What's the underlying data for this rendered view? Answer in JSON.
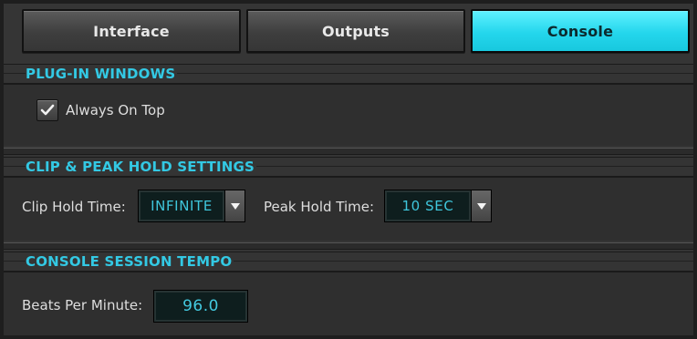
{
  "tabs": {
    "interface": "Interface",
    "outputs": "Outputs",
    "console": "Console"
  },
  "sections": {
    "plugin_windows": {
      "title": "PLUG-IN WINDOWS",
      "always_on_top_label": "Always On Top",
      "always_on_top_checked": true
    },
    "clip_peak": {
      "title": "CLIP & PEAK HOLD SETTINGS",
      "clip_hold_label": "Clip Hold Time:",
      "clip_hold_value": "INFINITE",
      "peak_hold_label": "Peak Hold Time:",
      "peak_hold_value": "10 SEC"
    },
    "tempo": {
      "title": "CONSOLE SESSION TEMPO",
      "bpm_label": "Beats Per Minute:",
      "bpm_value": "96.0"
    }
  },
  "colors": {
    "accent": "#33c9e4",
    "active_tab": "#24d6ec",
    "panel_bg": "#2f2f2f"
  },
  "icons": {
    "check": "checkmark-icon",
    "dropdown": "triangle-down-icon"
  }
}
